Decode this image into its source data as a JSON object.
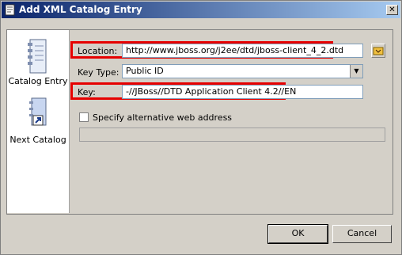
{
  "window": {
    "title": "Add XML Catalog Entry",
    "close_glyph": "✕"
  },
  "sidebar": {
    "items": [
      {
        "label": "Catalog Entry",
        "icon": "catalog-entry-icon"
      },
      {
        "label": "Next Catalog",
        "icon": "next-catalog-icon"
      }
    ]
  },
  "form": {
    "location_label": "Location:",
    "location_value": "http://www.jboss.org/j2ee/dtd/jboss-client_4_2.dtd",
    "key_type_label": "Key Type:",
    "key_type_value": "Public ID",
    "key_label": "Key:",
    "key_value": "-//JBoss//DTD Application Client 4.2//EN",
    "alt_web_label": "Specify alternative web address",
    "alt_web_checked": false,
    "alt_web_value": ""
  },
  "buttons": {
    "ok": "OK",
    "cancel": "Cancel"
  },
  "colors": {
    "highlight": "#e60000",
    "title_start": "#0a246a",
    "title_end": "#a6caf0"
  }
}
